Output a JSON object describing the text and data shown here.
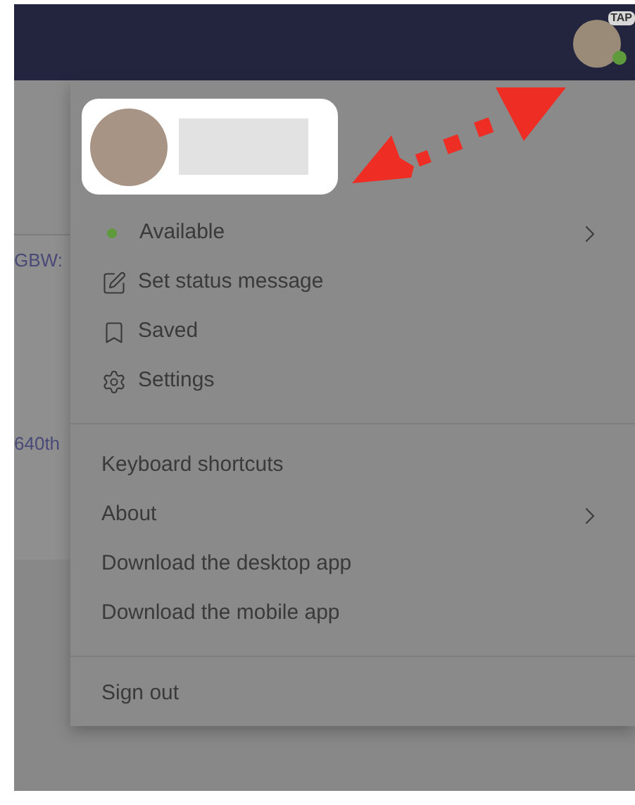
{
  "top_bar": {
    "badge": "TAP"
  },
  "side_list": {
    "column_1": [
      "GBW:",
      "640th"
    ]
  },
  "profile_menu": {
    "status": {
      "label": "Available",
      "color": "#5f9a3c",
      "submenu": true
    },
    "items": [
      {
        "kind": "edit",
        "label": "Set status message",
        "submenu": false
      },
      {
        "kind": "bookmark",
        "label": "Saved",
        "submenu": false
      },
      {
        "kind": "settings",
        "label": "Settings",
        "submenu": false
      }
    ],
    "more_items": [
      {
        "label": "Keyboard shortcuts",
        "submenu": false
      },
      {
        "label": "About",
        "submenu": true
      },
      {
        "label": "Download the desktop app",
        "submenu": false
      },
      {
        "label": "Download the mobile app",
        "submenu": false
      }
    ],
    "sign_out": "Sign out"
  }
}
